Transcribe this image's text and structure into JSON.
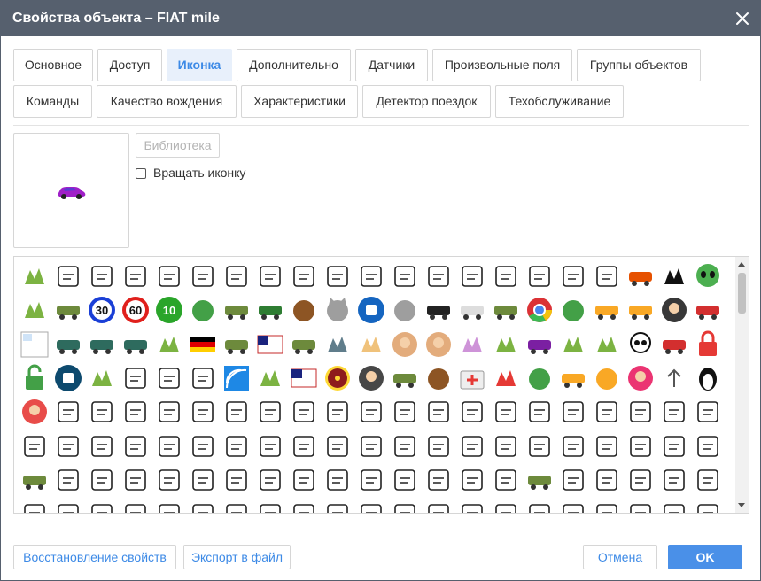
{
  "window": {
    "title": "Свойства объекта – FIAT mile"
  },
  "tabs": [
    {
      "label": "Основное",
      "active": false
    },
    {
      "label": "Доступ",
      "active": false
    },
    {
      "label": "Иконка",
      "active": true
    },
    {
      "label": "Дополнительно",
      "active": false
    },
    {
      "label": "Датчики",
      "active": false
    },
    {
      "label": "Произвольные поля",
      "active": false
    },
    {
      "label": "Группы объектов",
      "active": false
    },
    {
      "label": "Команды",
      "active": false
    },
    {
      "label": "Качество вождения",
      "active": false
    },
    {
      "label": "Характеристики",
      "active": false
    },
    {
      "label": "Детектор поездок",
      "active": false
    },
    {
      "label": "Техобслуживание",
      "active": false
    }
  ],
  "icon_panel": {
    "library_button": "Библиотека",
    "rotate_label": "Вращать иконку",
    "rotate_checked": false,
    "current_icon": "purple-car-icon"
  },
  "gallery": {
    "icons": [
      [
        "plant-icon",
        "gate-icon",
        "bride-icon",
        "wedding-cake-icon",
        "calendar-heart-icon",
        "bride-dress-icon",
        "flowers-icon",
        "champagne-icon",
        "heart-icon",
        "love-letter-icon",
        "location-heart-icon",
        "microphone-icon",
        "music-note-icon",
        "notebook-icon",
        "camera-icon",
        "doctor-icon",
        "ring-icon",
        "movie-camera-icon",
        "excavator-icon",
        "airplane-icon",
        "alien-icon",
        "warehouse-icon"
      ],
      [
        "rabbit-icon",
        "harvester-icon",
        "speed-limit-30-icon",
        "speed-limit-60-icon",
        "speed-limit-10-icon",
        "frog-icon",
        "military-truck-icon",
        "tractor-icon",
        "cow-icon",
        "cat-icon",
        "robot-badge-icon",
        "seal-icon",
        "black-car-icon",
        "white-car-icon",
        "tow-truck-icon",
        "chrome-icon",
        "octopus-icon",
        "school-bus-icon",
        "dump-truck-icon",
        "gentleman-icon",
        "red-car-icon",
        "minion-icon"
      ],
      [
        "broken-image-icon",
        "tank-icon",
        "tanks-icon",
        "tank-group-icon",
        "soldier-icon",
        "germany-flag-icon",
        "ambulance-icon",
        "usa-flag-icon",
        "bus-route-icon",
        "database-add-icon",
        "footprints-icon",
        "woman-avatar-icon",
        "boy-avatar-icon",
        "tea-cup-icon",
        "family-icon",
        "purple-car-top-icon",
        "map-icon",
        "flowers-bouquet-icon",
        "skull-icon",
        "red-car-crash-icon",
        "lock-icon"
      ],
      [
        "unlock-icon",
        "bus-badge-icon",
        "fireworks-icon",
        "person-laptop-icon",
        "mail-icon",
        "projector-icon",
        "wifi-icon",
        "flag-stripes-icon",
        "eagle-icon",
        "radiation-icon",
        "nun-icon",
        "truck-icon",
        "deer-icon",
        "first-aid-kit-icon",
        "rocket-icon",
        "sprout-icon",
        "bulldozer-icon",
        "lion-icon",
        "clown-icon",
        "arrow-up-icon",
        "linux-penguin-icon",
        "blue-dot-icon",
        "blue-dot-icon"
      ],
      [
        "santa-icon",
        "flask-icon",
        "books-icon",
        "brain-icon",
        "calendar-icon",
        "trophy-icon",
        "discount-badge-icon",
        "presentation-icon",
        "glasses-icon",
        "group-icon",
        "graduation-cap-icon",
        "hourglass-icon",
        "lightbulb-icon",
        "clipboard-icon",
        "map-pin-icon",
        "envelope-icon",
        "smartphone-icon",
        "wallet-icon",
        "receptionist-icon",
        "student-icon",
        "stopwatch-icon",
        "chat-icon"
      ],
      [
        "calendar-grid-icon",
        "armchair-icon",
        "globe-icon",
        "headset-support-icon",
        "graduation-cap-2-icon",
        "envelope-2-icon",
        "magnifier-icon",
        "phone-call-icon",
        "planner-icon",
        "clock-board-icon",
        "wallet-2-icon",
        "hourglass-2-icon",
        "gauge-icon",
        "award-icon",
        "star-icon",
        "hierarchy-icon",
        "target-icon",
        "video-player-icon",
        "webcam-icon",
        "shopping-bag-icon",
        "package-icon",
        "credit-card-icon"
      ],
      [
        "shopping-cart-icon",
        "calculator-icon",
        "settings-gear-icon",
        "sale-tag-icon",
        "clapping-hands-icon",
        "bearded-man-icon",
        "at-sign-icon",
        "user-icon",
        "map-location-icon",
        "money-icon",
        "badge-100-icon",
        "mobile-phone-icon",
        "recycle-icon",
        "24-hours-icon",
        "store-icon",
        "delivery-truck-icon",
        "compass-icon",
        "balloons-icon",
        "birthday-cake-icon",
        "calendar-dates-icon",
        "cocktail-icon",
        "couple-icon"
      ],
      [
        "disco-ball-icon",
        "cake-stand-icon",
        "document-icon",
        "envelope-3-icon",
        "location-pin-icon",
        "magic-wand-icon",
        "chef-icon",
        "microphone-2-icon",
        "music-notes-icon",
        "cloud-person-icon",
        "gift-icon",
        "phone-2-icon",
        "smiley-icon",
        "sunrise-icon",
        "film-camera-icon",
        "speech-bubble-icon",
        "ribbon-icon",
        "glass-icon",
        "cone-icon",
        "lipstick-icon",
        "coffee-cup-icon",
        "settings-2-icon"
      ]
    ]
  },
  "footer": {
    "restore_label": "Восстановление свойств",
    "export_label": "Экспорт в файл",
    "cancel_label": "Отмена",
    "ok_label": "OK"
  }
}
